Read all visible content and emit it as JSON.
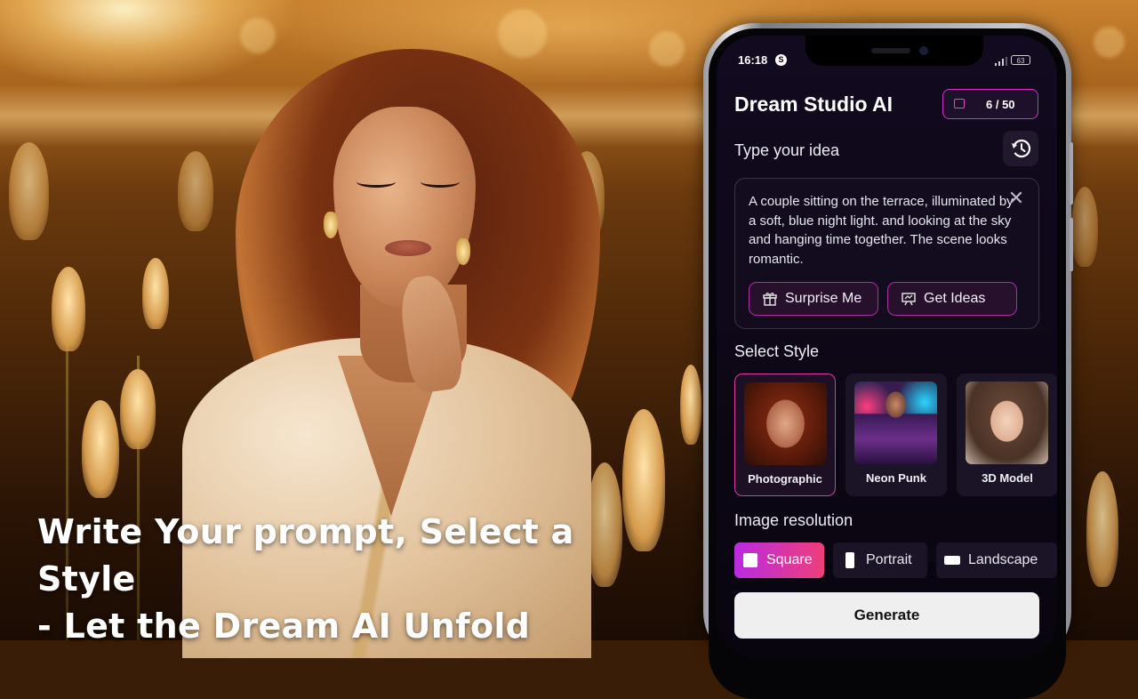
{
  "hero": {
    "caption_line1": "Write Your prompt, Select a Style",
    "caption_line2": "- Let the Dream AI Unfold"
  },
  "status_bar": {
    "time": "16:18",
    "app_badge": "S",
    "battery": "63"
  },
  "app": {
    "title": "Dream Studio AI",
    "credits": "6 / 50",
    "accent": "#d02fc6"
  },
  "prompt": {
    "label": "Type your idea",
    "text": "A couple sitting on the terrace, illuminated by a soft, blue night light. and looking at the sky and hanging time together. The scene looks romantic.",
    "surprise_label": "Surprise Me",
    "ideas_label": "Get Ideas",
    "clear_icon": "close-icon",
    "history_icon": "history-icon"
  },
  "styles": {
    "label": "Select Style",
    "items": [
      {
        "name": "Photographic",
        "selected": true
      },
      {
        "name": "Neon Punk",
        "selected": false
      },
      {
        "name": "3D Model",
        "selected": false
      }
    ]
  },
  "resolution": {
    "label": "Image resolution",
    "options": [
      {
        "name": "Square",
        "selected": true
      },
      {
        "name": "Portrait",
        "selected": false
      },
      {
        "name": "Landscape",
        "selected": false
      }
    ]
  },
  "generate_label": "Generate"
}
